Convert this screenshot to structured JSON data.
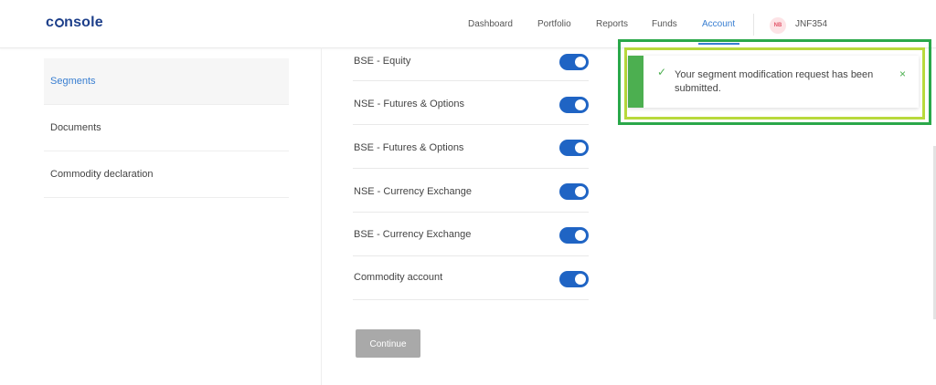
{
  "header": {
    "logo": "console",
    "nav": [
      "Dashboard",
      "Portfolio",
      "Reports",
      "Funds",
      "Account"
    ],
    "active_nav": "Account",
    "avatar_initials": "NB",
    "user_id": "JNF354"
  },
  "sidebar": {
    "items": [
      {
        "label": "Segments",
        "active": true
      },
      {
        "label": "Documents",
        "active": false
      },
      {
        "label": "Commodity declaration",
        "active": false
      }
    ]
  },
  "segments": [
    {
      "label": "BSE - Equity",
      "enabled": true
    },
    {
      "label": "NSE - Futures & Options",
      "enabled": true
    },
    {
      "label": "BSE - Futures & Options",
      "enabled": true
    },
    {
      "label": "NSE - Currency Exchange",
      "enabled": true
    },
    {
      "label": "BSE - Currency Exchange",
      "enabled": true
    },
    {
      "label": "Commodity account",
      "enabled": true
    }
  ],
  "continue_label": "Continue",
  "toast": {
    "message": "Your segment modification request has been submitted.",
    "close_glyph": "×",
    "check_glyph": "✓"
  },
  "colors": {
    "accent": "#387ed1",
    "toggle_on": "#1f64c4",
    "success": "#4caf50",
    "button_disabled": "#a9a9a9"
  }
}
